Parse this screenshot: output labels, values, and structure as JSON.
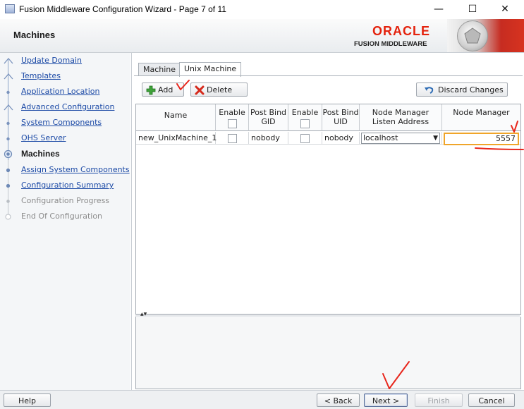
{
  "window": {
    "title": "Fusion Middleware Configuration Wizard - Page 7 of 11",
    "minimize_icon": "minimize-icon",
    "maximize_icon": "maximize-icon",
    "close_icon": "close-icon"
  },
  "header": {
    "page_title": "Machines",
    "brand": "ORACLE",
    "subbrand": "FUSION MIDDLEWARE"
  },
  "nav": {
    "items": [
      {
        "label": "Update Domain",
        "state": "done"
      },
      {
        "label": "Templates",
        "state": "done"
      },
      {
        "label": "Application Location",
        "state": "done"
      },
      {
        "label": "Advanced Configuration",
        "state": "done"
      },
      {
        "label": "System Components",
        "state": "done"
      },
      {
        "label": "OHS Server",
        "state": "done"
      },
      {
        "label": "Machines",
        "state": "current"
      },
      {
        "label": "Assign System Components",
        "state": "next"
      },
      {
        "label": "Configuration Summary",
        "state": "next"
      },
      {
        "label": "Configuration Progress",
        "state": "disabled"
      },
      {
        "label": "End Of Configuration",
        "state": "disabled"
      }
    ]
  },
  "tabs": [
    {
      "label": "Machine",
      "active": false
    },
    {
      "label": "Unix Machine",
      "active": true
    }
  ],
  "toolbar": {
    "add_label": "Add",
    "delete_label": "Delete",
    "discard_label": "Discard Changes"
  },
  "table": {
    "columns": [
      "Name",
      "Enable",
      "Post Bind GID",
      "Enable",
      "Post Bind UID",
      "Node Manager Listen Address",
      "Node Manager"
    ],
    "rows": [
      {
        "name": "new_UnixMachine_1",
        "enable_gid": false,
        "post_bind_gid": "nobody",
        "enable_uid": false,
        "post_bind_uid": "nobody",
        "listen_address": "localhost",
        "port": "5557"
      }
    ]
  },
  "footer": {
    "help_label": "Help",
    "back_label": "< Back",
    "next_label": "Next >",
    "finish_label": "Finish",
    "cancel_label": "Cancel"
  },
  "colors": {
    "oracle_red": "#e4220d",
    "link_blue": "#1c4aa6",
    "annotation_red": "#e8261c",
    "port_highlight": "#f0a52a"
  }
}
